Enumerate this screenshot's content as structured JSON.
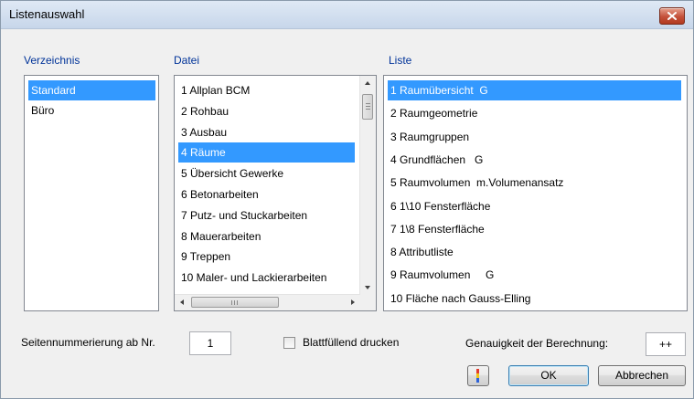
{
  "window": {
    "title": "Listenauswahl",
    "close_icon": "close-icon"
  },
  "verzeichnis": {
    "label": "Verzeichnis",
    "items": [
      {
        "label": "Standard",
        "selected": true
      },
      {
        "label": "Büro",
        "selected": false
      }
    ]
  },
  "datei": {
    "label": "Datei",
    "items": [
      {
        "label": "1 Allplan BCM",
        "selected": false
      },
      {
        "label": "2 Rohbau",
        "selected": false
      },
      {
        "label": "3 Ausbau",
        "selected": false
      },
      {
        "label": "4 Räume",
        "selected": true
      },
      {
        "label": "5 Übersicht Gewerke",
        "selected": false
      },
      {
        "label": "6 Betonarbeiten",
        "selected": false
      },
      {
        "label": "7 Putz- und Stuckarbeiten",
        "selected": false
      },
      {
        "label": "8 Mauerarbeiten",
        "selected": false
      },
      {
        "label": "9 Treppen",
        "selected": false
      },
      {
        "label": "10 Maler- und Lackierarbeiten",
        "selected": false
      }
    ]
  },
  "liste": {
    "label": "Liste",
    "items": [
      {
        "label": "1 Raumübersicht  G",
        "selected": true
      },
      {
        "label": "2 Raumgeometrie",
        "selected": false
      },
      {
        "label": "3 Raumgruppen",
        "selected": false
      },
      {
        "label": "4 Grundflächen   G",
        "selected": false
      },
      {
        "label": "5 Raumvolumen  m.Volumenansatz",
        "selected": false
      },
      {
        "label": "6 1\\10 Fensterfläche",
        "selected": false
      },
      {
        "label": "7 1\\8 Fensterfläche",
        "selected": false
      },
      {
        "label": "8 Attributliste",
        "selected": false
      },
      {
        "label": "9 Raumvolumen     G",
        "selected": false
      },
      {
        "label": "10 Fläche nach Gauss-Elling",
        "selected": false
      }
    ]
  },
  "footer": {
    "page_numbering_label": "Seitennummerierung ab Nr.",
    "page_numbering_value": "1",
    "fill_page_label": "Blattfüllend drucken",
    "fill_page_checked": false,
    "precision_label": "Genauigkeit der Berechnung:",
    "precision_value": "++",
    "ok_label": "OK",
    "cancel_label": "Abbrechen"
  },
  "colors": {
    "selection": "#3399ff",
    "group_label": "#003399"
  }
}
